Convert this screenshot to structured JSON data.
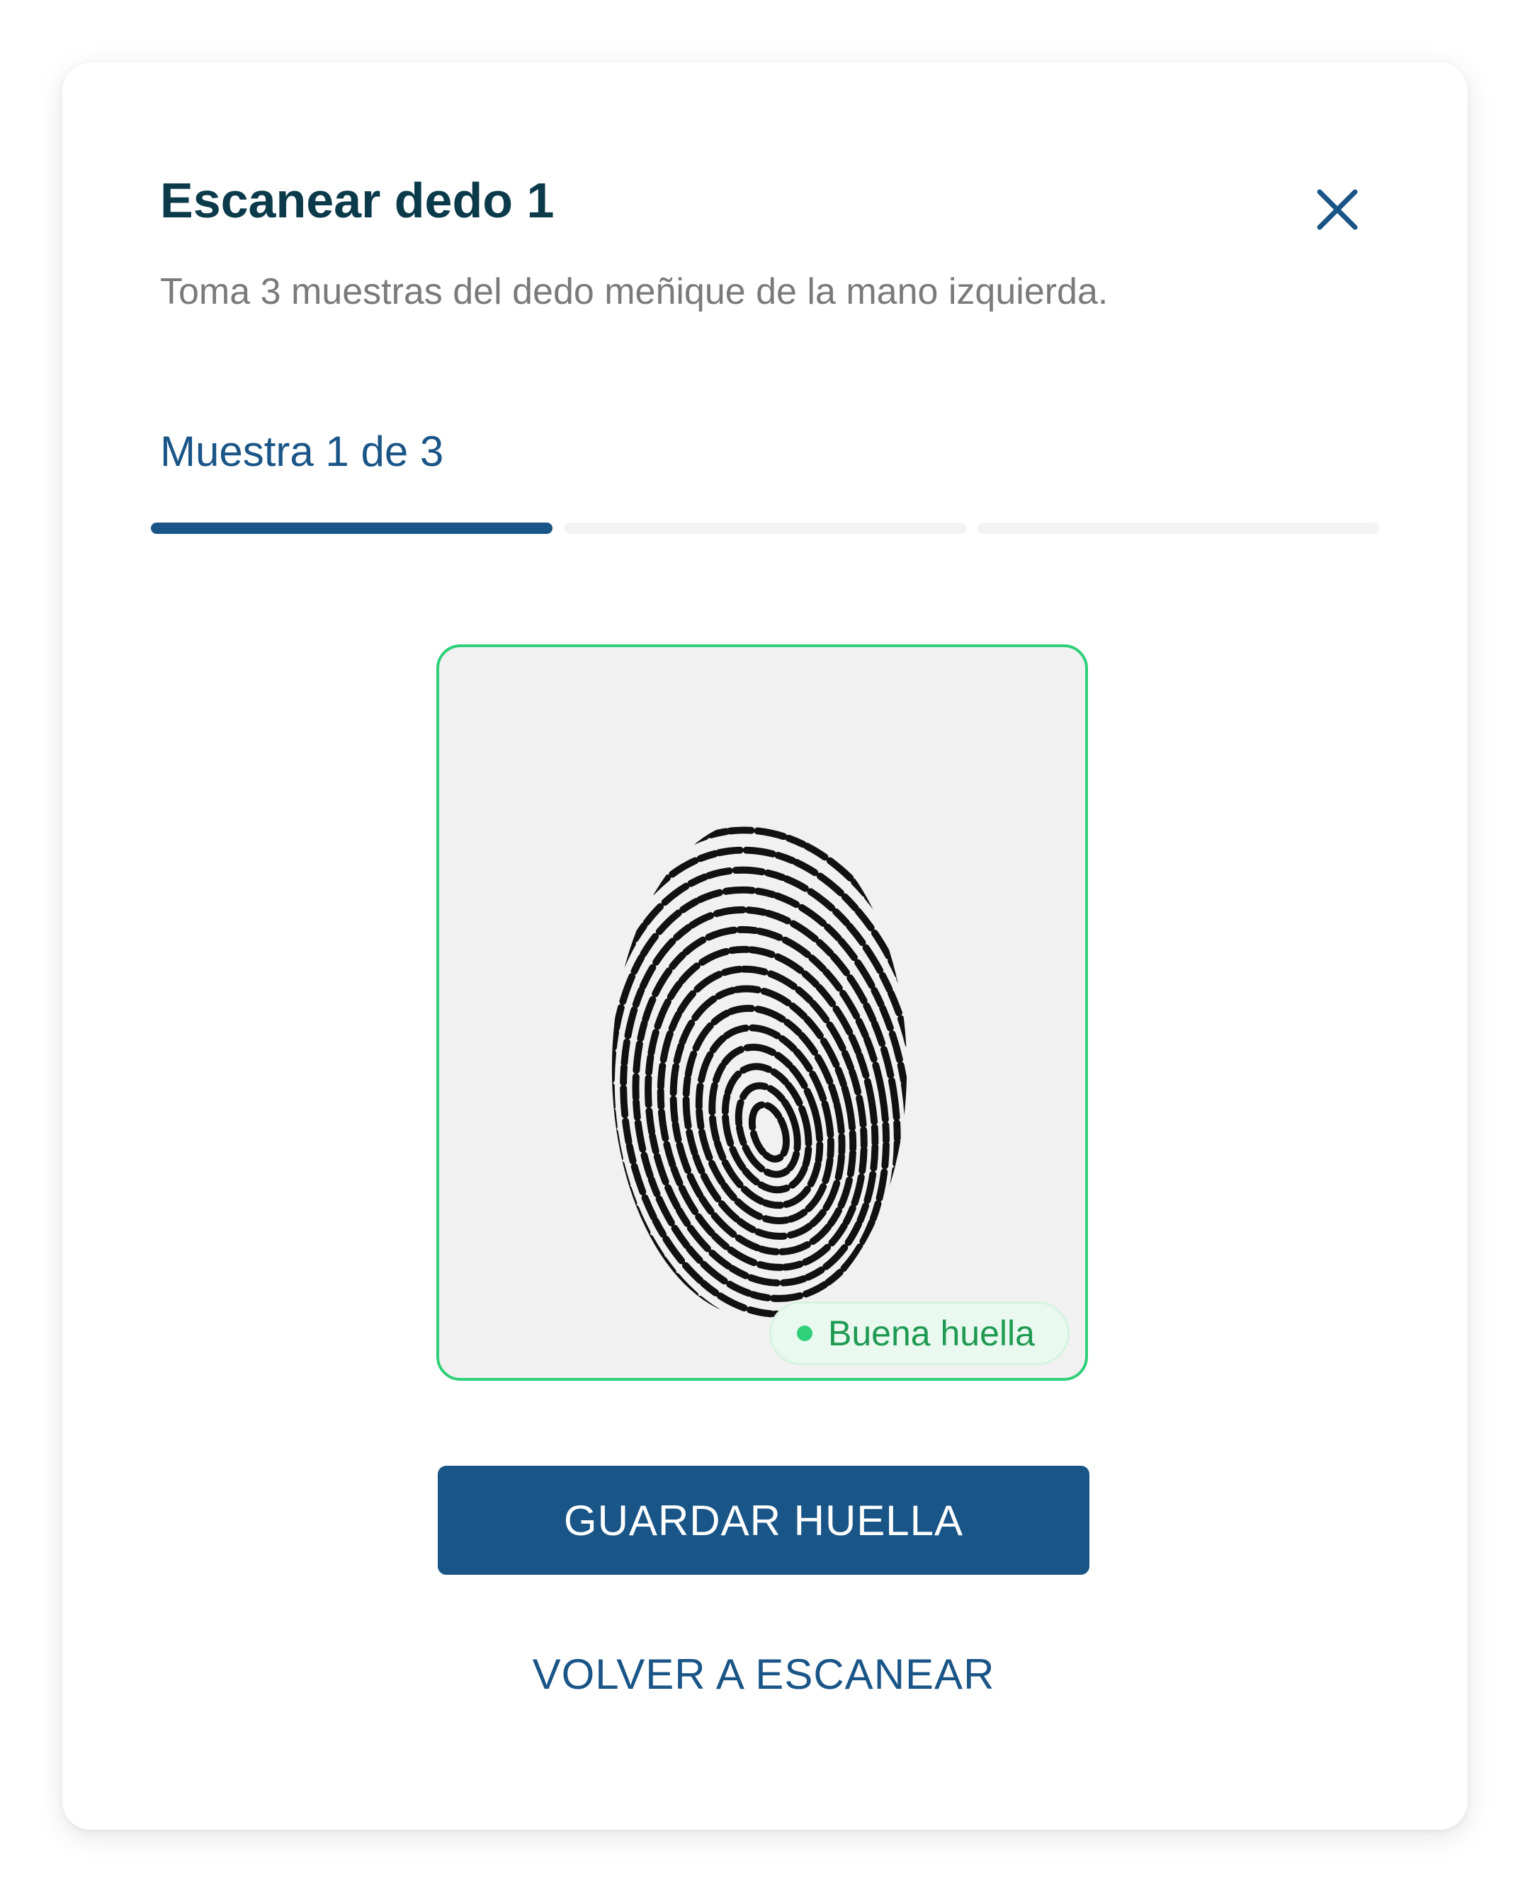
{
  "dialog": {
    "title": "Escanear dedo 1",
    "subtitle": "Toma 3 muestras del dedo meñique de la mano izquierda.",
    "close_icon": "close-icon"
  },
  "progress": {
    "label": "Muestra 1 de 3",
    "current": 1,
    "total": 3
  },
  "scan": {
    "image": "fingerprint",
    "quality_label": "Buena huella",
    "quality_color": "#2fd07a"
  },
  "actions": {
    "primary_label": "GUARDAR HUELLA",
    "secondary_label": "VOLVER A ESCANEAR"
  },
  "colors": {
    "title": "#0b3a4a",
    "accent": "#1a5587",
    "success": "#2fd07a",
    "success_text": "#1e9a52",
    "muted_text": "#7a7a7a"
  }
}
